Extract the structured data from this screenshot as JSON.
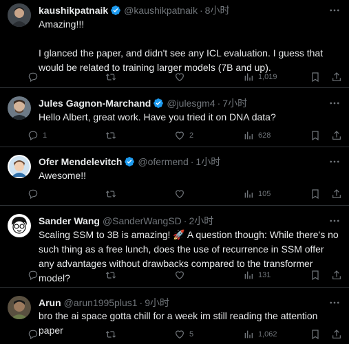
{
  "colors": {
    "background": "#000000",
    "text": "#e7e9ea",
    "muted": "#71767b",
    "verified": "#1d9bf0",
    "divider": "#2f3336"
  },
  "tweets": [
    {
      "name": "kaushikpatnaik",
      "verified": true,
      "handle": "@kaushikpatnaik",
      "time": "8小时",
      "text": [
        "Amazing!!!",
        "",
        "I glanced the paper, and didn't see any ICL evaluation. I guess that would be related to training larger models (7B and up)."
      ],
      "replies": "",
      "reposts": "",
      "likes": "",
      "views": "1,019"
    },
    {
      "name": "Jules Gagnon-Marchand",
      "verified": true,
      "handle": "@julesgm4",
      "time": "7小时",
      "text": [
        "Hello Albert, great work. Have you tried it on DNA data?"
      ],
      "replies": "1",
      "reposts": "",
      "likes": "2",
      "views": "628"
    },
    {
      "name": "Ofer Mendelevitch",
      "verified": true,
      "handle": "@ofermend",
      "time": "1小时",
      "text": [
        "Awesome!!"
      ],
      "replies": "",
      "reposts": "",
      "likes": "",
      "views": "105"
    },
    {
      "name": "Sander Wang",
      "verified": false,
      "handle": "@SanderWangSD",
      "time": "2小时",
      "text": [
        "Scaling SSM to 3B is amazing! 🚀 A question though: While there's no such thing as a free lunch, does the use of recurrence in SSM offer any advantages without drawbacks compared to the transformer model?"
      ],
      "replies": "",
      "reposts": "",
      "likes": "",
      "views": "131"
    },
    {
      "name": "Arun",
      "verified": false,
      "handle": "@arun1995plus1",
      "time": "9小时",
      "text": [
        "bro the ai space gotta chill for a week im still reading the attention paper"
      ],
      "replies": "",
      "reposts": "",
      "likes": "5",
      "views": "1,062"
    }
  ]
}
